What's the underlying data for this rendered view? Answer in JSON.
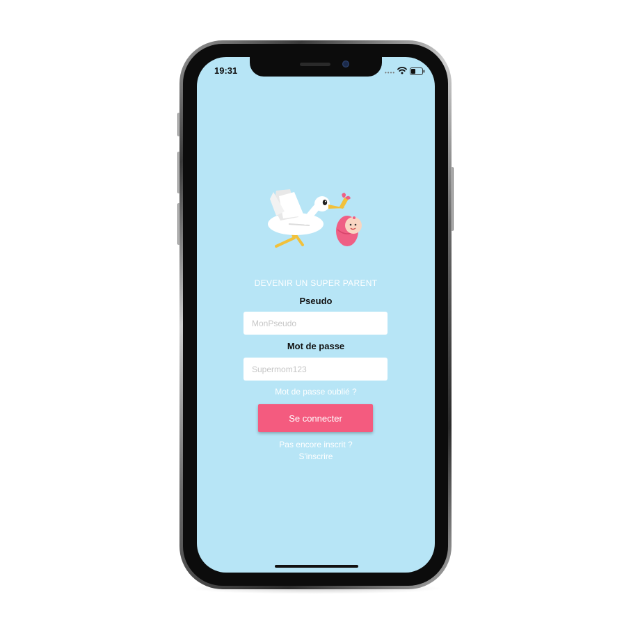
{
  "status_bar": {
    "time": "19:31",
    "icons": [
      "signal-dots-icon",
      "wifi-icon",
      "battery-icon"
    ]
  },
  "login": {
    "headline": "DEVENIR UN SUPER PARENT",
    "pseudo_label": "Pseudo",
    "pseudo_placeholder": "MonPseudo",
    "pseudo_value": "",
    "password_label": "Mot de passe",
    "password_placeholder": "Supermom123",
    "password_value": "",
    "forgot_link": "Mot de passe oublié ?",
    "connect_button": "Se connecter",
    "signup_question": "Pas encore inscrit ?",
    "signup_link": "S'inscrire"
  },
  "illustration": "stork-carrying-baby-icon",
  "colors": {
    "background": "#b7e5f6",
    "button": "#f45b7f",
    "text_on_bg": "#ffffff",
    "label": "#111111"
  }
}
